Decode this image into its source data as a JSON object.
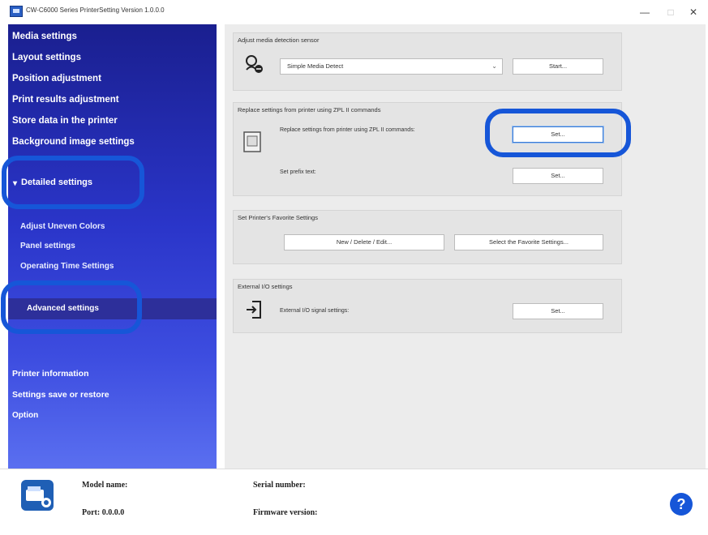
{
  "window": {
    "title": "CW-C6000 Series PrinterSetting Version 1.0.0.0",
    "minimize_glyph": "—",
    "maximize_glyph": "□",
    "close_glyph": "✕"
  },
  "sidebar": {
    "items": [
      {
        "label": "Media settings"
      },
      {
        "label": "Layout settings"
      },
      {
        "label": "Position adjustment"
      },
      {
        "label": "Print results adjustment"
      },
      {
        "label": "Store data in the printer"
      },
      {
        "label": "Background image settings"
      }
    ],
    "detailed": {
      "label": "Detailed settings",
      "arrow": "▾"
    },
    "sub_items": [
      {
        "label": "Adjust Uneven Colors"
      },
      {
        "label": "Panel settings"
      },
      {
        "label": "Operating Time Settings"
      }
    ],
    "advanced": {
      "label": "Advanced settings"
    },
    "bottom_items": [
      {
        "label": "Printer information"
      },
      {
        "label": "Settings save or restore"
      },
      {
        "label": "Option"
      }
    ]
  },
  "sections": {
    "media_sensor": {
      "title": "Adjust media detection sensor",
      "select_value": "Simple Media Detect",
      "start_button": "Start..."
    },
    "zpl": {
      "title": "Replace settings from printer using ZPL II commands",
      "row1_label": "Replace settings from printer using ZPL II commands:",
      "row1_button": "Set...",
      "row2_label": "Set prefix text:",
      "row2_button": "Set..."
    },
    "favorite": {
      "title": "Set Printer's Favorite Settings",
      "new_button": "New / Delete / Edit...",
      "select_button": "Select the Favorite Settings..."
    },
    "external_io": {
      "title": "External I/O settings",
      "label": "External I/O signal settings:",
      "button": "Set..."
    }
  },
  "footer": {
    "model_label": "Model name:",
    "port_label": "Port: 0.0.0.0",
    "serial_label": "Serial number:",
    "firmware_label": "Firmware version:",
    "help_glyph": "?"
  },
  "colors": {
    "sidebar_top": "#1a1f8f",
    "sidebar_bottom": "#5a6ff0",
    "highlight_ring": "#1656d8",
    "help_icon": "#1656d8"
  }
}
